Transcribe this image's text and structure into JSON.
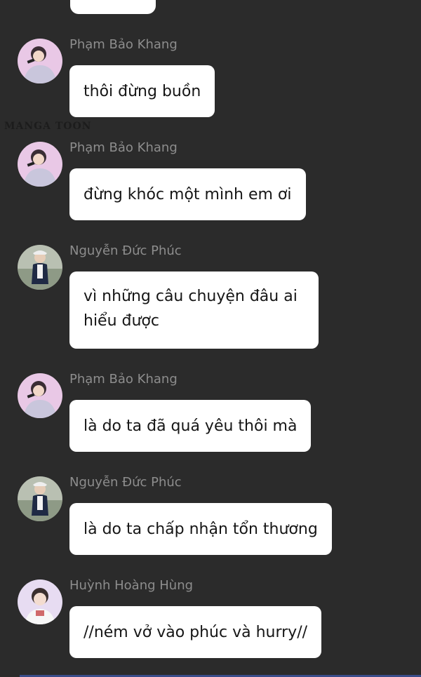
{
  "watermark": "MANGA TOON",
  "colors": {
    "background": "#2b2b2b",
    "bubble": "#ffffff",
    "name": "#8d8d8d",
    "text": "#161616"
  },
  "messages": [
    {
      "sender": "Phạm Bảo Khang",
      "text": "thôi đừng buồn",
      "avatar": "avatar-khang"
    },
    {
      "sender": "Phạm Bảo Khang",
      "text": "đừng khóc một mình em ơi",
      "avatar": "avatar-khang"
    },
    {
      "sender": "Nguyễn Đức Phúc",
      "text": "vì những câu chuyện đâu ai hiểu được",
      "avatar": "avatar-phuc"
    },
    {
      "sender": "Phạm Bảo Khang",
      "text": "là do ta đã quá yêu thôi mà",
      "avatar": "avatar-khang"
    },
    {
      "sender": "Nguyễn Đức Phúc",
      "text": "là do ta chấp nhận tổn thương",
      "avatar": "avatar-phuc"
    },
    {
      "sender": "Huỳnh Hoàng Hùng",
      "text": "//ném vở vào phúc và hurry//",
      "avatar": "avatar-hung"
    }
  ]
}
